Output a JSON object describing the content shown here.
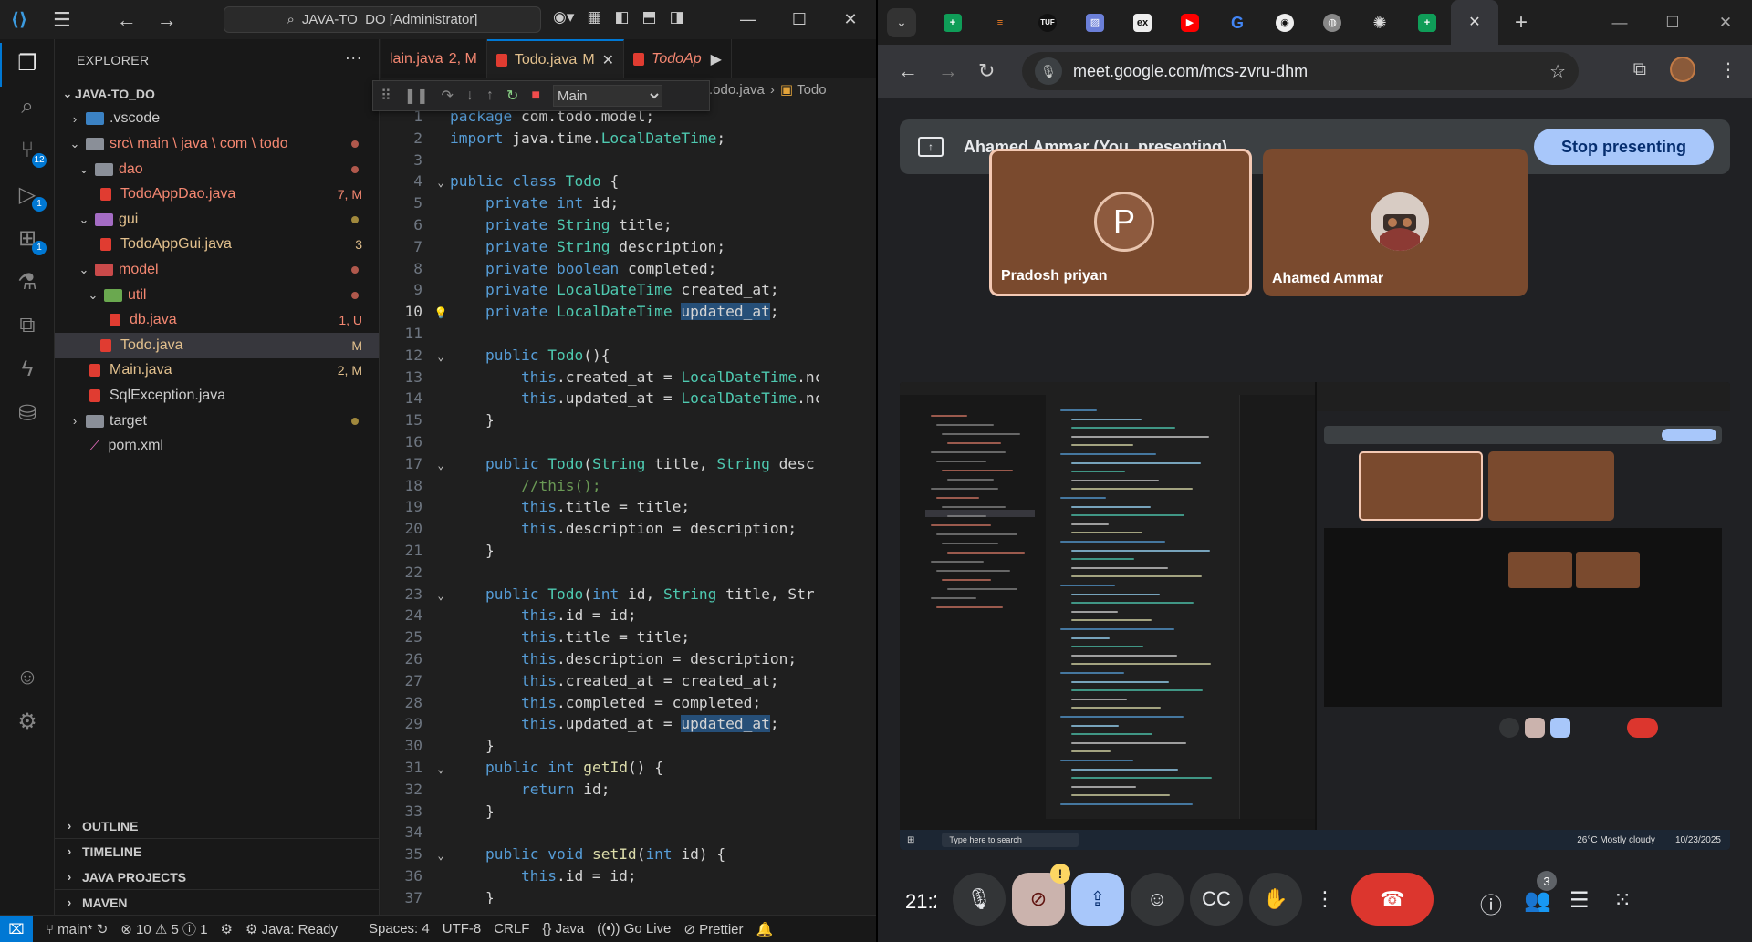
{
  "vscode": {
    "search": "JAVA-TO_DO [Administrator]",
    "explorer_title": "EXPLORER",
    "root_folder": "JAVA-TO_DO",
    "tree": [
      {
        "label": ".vscode",
        "status": ""
      },
      {
        "label": "src\\ main \\ java \\ com \\ todo",
        "status": ""
      },
      {
        "label": "dao",
        "status": ""
      },
      {
        "label": "TodoAppDao.java",
        "status": "7, M"
      },
      {
        "label": "gui",
        "status": ""
      },
      {
        "label": "TodoAppGui.java",
        "status": "3"
      },
      {
        "label": "model",
        "status": ""
      },
      {
        "label": "util",
        "status": ""
      },
      {
        "label": "db.java",
        "status": "1, U"
      },
      {
        "label": "Todo.java",
        "status": "M"
      },
      {
        "label": "Main.java",
        "status": "2, M"
      },
      {
        "label": "SqlException.java",
        "status": ""
      },
      {
        "label": "target",
        "status": ""
      },
      {
        "label": "pom.xml",
        "status": ""
      }
    ],
    "sections": [
      "OUTLINE",
      "TIMELINE",
      "JAVA PROJECTS",
      "MAVEN"
    ],
    "tabs": [
      {
        "label": "lain.java",
        "status": "2, M"
      },
      {
        "label": "Todo.java",
        "status": "M"
      },
      {
        "label": "TodoAp",
        "status": ""
      }
    ],
    "breadcrumb": [
      ".odo.java",
      "Todo"
    ],
    "debug_target": "Main",
    "badges": {
      "scm": "12",
      "run": "1",
      "ext": "1"
    },
    "code": [
      {
        "n": "1",
        "t": "package com.todo.model;"
      },
      {
        "n": "2",
        "t": "import java.time.LocalDateTime;"
      },
      {
        "n": "3",
        "t": ""
      },
      {
        "n": "4",
        "t": "public class Todo {"
      },
      {
        "n": "5",
        "t": "    private int id;"
      },
      {
        "n": "6",
        "t": "    private String title;"
      },
      {
        "n": "7",
        "t": "    private String description;"
      },
      {
        "n": "8",
        "t": "    private boolean completed;"
      },
      {
        "n": "9",
        "t": "    private LocalDateTime created_at;"
      },
      {
        "n": "10",
        "t": "    private LocalDateTime updated_at;"
      },
      {
        "n": "11",
        "t": ""
      },
      {
        "n": "12",
        "t": "    public Todo(){"
      },
      {
        "n": "13",
        "t": "        this.created_at = LocalDateTime.nc"
      },
      {
        "n": "14",
        "t": "        this.updated_at = LocalDateTime.nc"
      },
      {
        "n": "15",
        "t": "    }"
      },
      {
        "n": "16",
        "t": ""
      },
      {
        "n": "17",
        "t": "    public Todo(String title, String desc"
      },
      {
        "n": "18",
        "t": "        //this();"
      },
      {
        "n": "19",
        "t": "        this.title = title;"
      },
      {
        "n": "20",
        "t": "        this.description = description;"
      },
      {
        "n": "21",
        "t": "    }"
      },
      {
        "n": "22",
        "t": ""
      },
      {
        "n": "23",
        "t": "    public Todo(int id, String title, Str"
      },
      {
        "n": "24",
        "t": "        this.id = id;"
      },
      {
        "n": "25",
        "t": "        this.title = title;"
      },
      {
        "n": "26",
        "t": "        this.description = description;"
      },
      {
        "n": "27",
        "t": "        this.created_at = created_at;"
      },
      {
        "n": "28",
        "t": "        this.completed = completed;"
      },
      {
        "n": "29",
        "t": "        this.updated_at = updated_at;"
      },
      {
        "n": "30",
        "t": "    }"
      },
      {
        "n": "31",
        "t": "    public int getId() {"
      },
      {
        "n": "32",
        "t": "        return id;"
      },
      {
        "n": "33",
        "t": "    }"
      },
      {
        "n": "34",
        "t": ""
      },
      {
        "n": "35",
        "t": "    public void setId(int id) {"
      },
      {
        "n": "36",
        "t": "        this.id = id;"
      },
      {
        "n": "37",
        "t": "    }"
      }
    ],
    "status": {
      "branch": "main*",
      "errors": "10",
      "warnings": "5",
      "info": "1",
      "java": "Java: Ready",
      "spaces": "Spaces: 4",
      "encoding": "UTF-8",
      "eol": "CRLF",
      "lang": "Java",
      "golive": "Go Live",
      "prettier": "Prettier"
    }
  },
  "chrome": {
    "url": "meet.google.com/mcs-zvru-dhm",
    "presenting_text": "Ahamed Ammar (You, presenting)",
    "stop_presenting": "Stop presenting",
    "participants": [
      {
        "name": "Pradosh priyan",
        "initial": "P"
      },
      {
        "name": "Ahamed Ammar"
      }
    ],
    "clock": "21:2",
    "people_count": "3",
    "ss_search": "Type here to search",
    "ss_weather": "26°C  Mostly cloudy",
    "ss_time": "10/23/2025"
  }
}
